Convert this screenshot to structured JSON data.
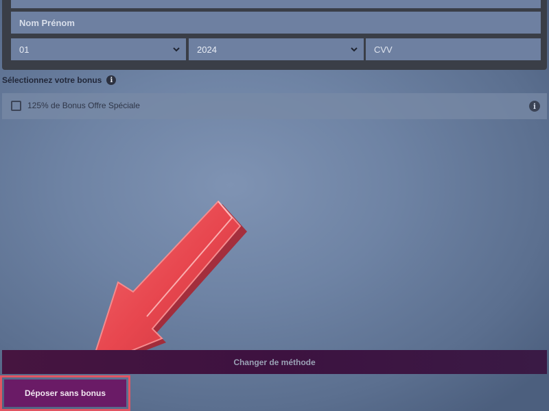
{
  "form": {
    "name_placeholder": "Nom Prénom",
    "month_value": "01",
    "year_value": "2024",
    "cvv_placeholder": "CVV"
  },
  "bonus": {
    "title": "Sélectionnez votre bonus",
    "info_glyph": "i",
    "option_label": "125% de Bonus Offre Spéciale",
    "option_checked": false
  },
  "actions": {
    "change_method_label": "Changer de méthode",
    "deposit_without_bonus_label": "Déposer sans bonus"
  },
  "icons": {
    "chevron": "chevron-down-icon",
    "info": "info-icon",
    "arrow": "pointer-arrow-icon"
  },
  "colors": {
    "accent_purple": "#6a1b66",
    "highlight_red": "#e25563",
    "arrow_red": "#e8474f"
  }
}
